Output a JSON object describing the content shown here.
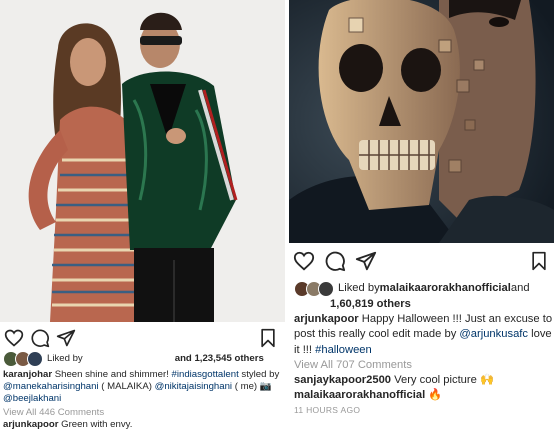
{
  "left_post": {
    "liked_label": "Liked by",
    "likes_count": "and 1,23,545 others",
    "caption_user": "karanjohar",
    "caption_text_1": " Sheen shine and shimmer! ",
    "caption_tag": "#indiasgottalent",
    "caption_text_2": " styled by",
    "mention_1": "@manekaharisinghani",
    "caption_text_3": " ( MALAIKA) ",
    "mention_2": "@nikitajaisinghani",
    "caption_text_4": " ( me) ",
    "camera_emoji": "📷",
    "mention_3": "@beejlakhani",
    "view_comments": "View All 446 Comments",
    "comment_user": "arjunkapoor",
    "comment_text": " Green with envy.",
    "icons": [
      "heart-icon",
      "comment-icon",
      "share-icon",
      "bookmark-icon"
    ]
  },
  "right_post": {
    "liked_label": "Liked by ",
    "liked_user": "malaikaarorakhanofficial",
    "liked_and": " and",
    "likes_count": "1,60,819 others",
    "caption_user": "arjunkapoor",
    "caption_text_1": " Happy Halloween !!! Just an excuse to",
    "caption_text_2": "post this really cool edit made by ",
    "mention_1": "@arjunkusafc",
    "caption_text_3": " love",
    "caption_text_4": "it !!! ",
    "caption_tag": "#halloween",
    "view_comments": "View All 707 Comments",
    "comment_1_user": "sanjaykapoor2500",
    "comment_1_text": " Very cool picture 🙌",
    "comment_2_user": "malaikaarorakhanofficial",
    "comment_2_text": " 🔥",
    "timestamp": "11 HOURS AGO",
    "icons": [
      "heart-icon",
      "comment-icon",
      "share-icon",
      "bookmark-icon"
    ]
  },
  "colors": {
    "text": "#262626",
    "link": "#003569",
    "muted": "#999999",
    "background": "#ffffff"
  }
}
